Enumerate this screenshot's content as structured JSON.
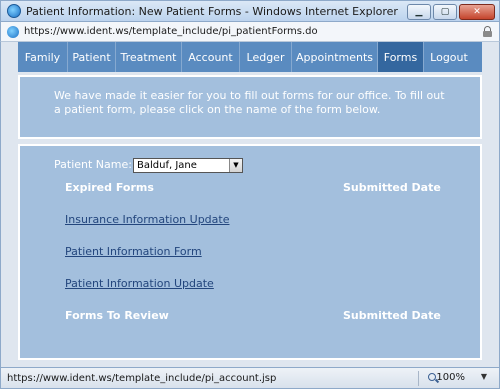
{
  "window": {
    "title": "Patient Information: New Patient Forms - Windows Internet Explorer",
    "url": "https://www.ident.ws/template_include/pi_patientForms.do",
    "minimize_glyph": "▁",
    "maximize_glyph": "▢",
    "close_glyph": "✕"
  },
  "nav": {
    "items": [
      {
        "label": "Family"
      },
      {
        "label": "Patient"
      },
      {
        "label": "Treatment"
      },
      {
        "label": "Account"
      },
      {
        "label": "Ledger"
      },
      {
        "label": "Appointments"
      },
      {
        "label": "Forms",
        "active": true
      },
      {
        "label": "Logout"
      }
    ]
  },
  "intro": {
    "text": "We have made it easier for you to fill out forms for our office. To fill out a patient form, please click on the name of the form below."
  },
  "patient": {
    "label": "Patient Name:",
    "selected": "Balduf, Jane",
    "arrow": "▼"
  },
  "expired": {
    "heading": "Expired Forms",
    "date_heading": "Submitted Date",
    "forms": [
      {
        "name": "Insurance Information Update"
      },
      {
        "name": "Patient Information Form"
      },
      {
        "name": "Patient Information Update"
      }
    ]
  },
  "review": {
    "heading": "Forms To Review",
    "date_heading": "Submitted Date"
  },
  "status": {
    "url": "https://www.ident.ws/template_include/pi_account.jsp",
    "zoom": "100%",
    "zoom_arrow": "▼"
  },
  "colors": {
    "nav_bg": "#5a8bc0",
    "nav_active": "#34679f",
    "panel_bg": "#a3bfdd",
    "link": "#23467d"
  }
}
